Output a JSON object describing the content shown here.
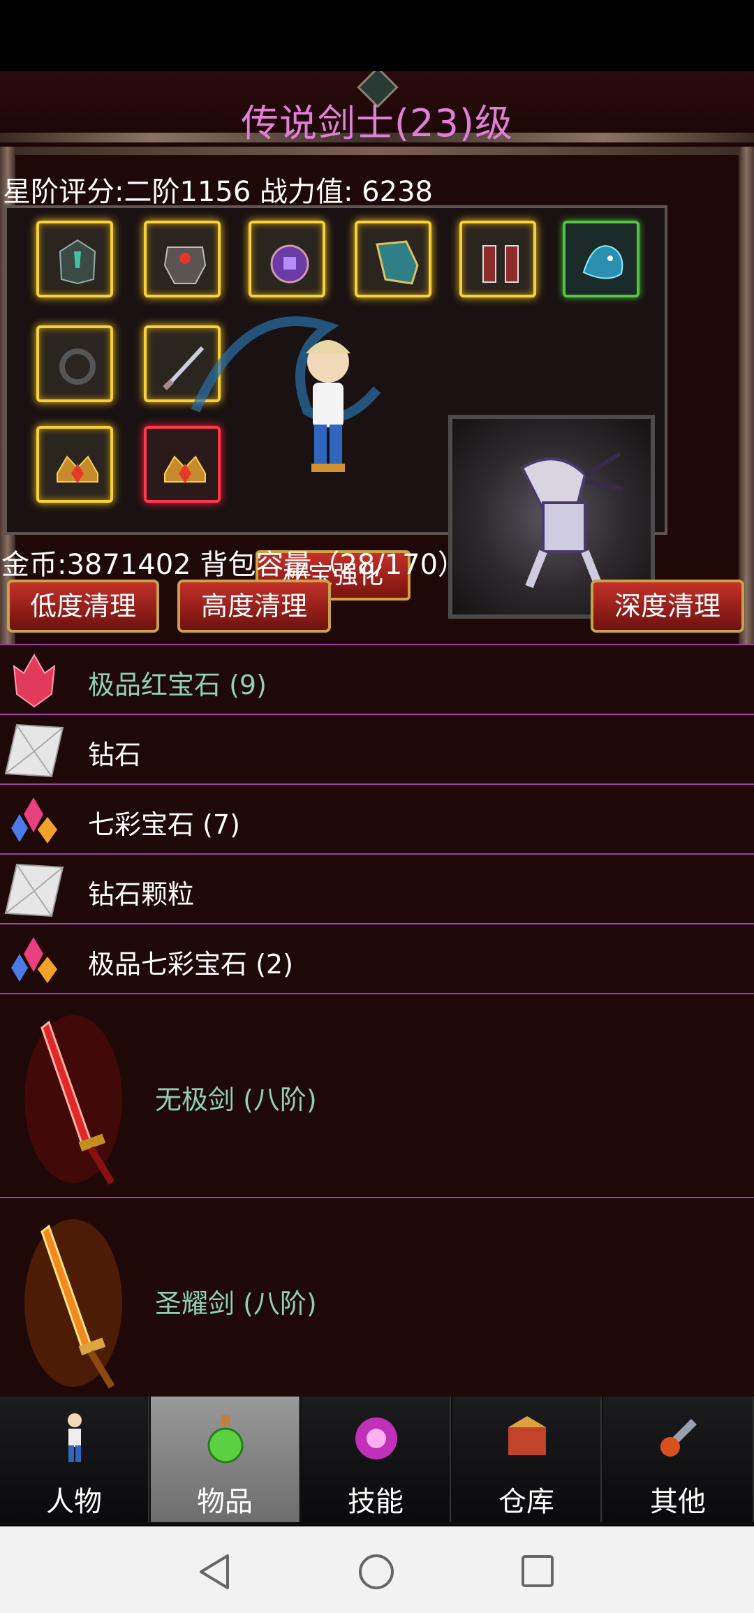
{
  "header": {
    "title": "传说剑士(23)级"
  },
  "stats": {
    "score_line": "星阶评分:二阶1156 战力值:  6238"
  },
  "equip": {
    "secret_button": "秘宝强化"
  },
  "inventory": {
    "gold_line": "金币:3871402 背包容量（28/170）",
    "clean_buttons": [
      "低度清理",
      "高度清理",
      "深度清理"
    ],
    "items": [
      {
        "name": "极品红宝石 (9)",
        "color": "#8fd0b4",
        "icon": "red-crystal-icon"
      },
      {
        "name": "钻石",
        "color": "#ffffff",
        "icon": "diamond-icon"
      },
      {
        "name": "七彩宝石 (7)",
        "color": "#ffffff",
        "icon": "rainbow-gem-icon"
      },
      {
        "name": "钻石颗粒",
        "color": "#ffffff",
        "icon": "diamond-particle-icon"
      },
      {
        "name": "极品七彩宝石 (2)",
        "color": "#ffffff",
        "icon": "rainbow-gem-icon"
      },
      {
        "name": "无极剑 (八阶)",
        "color": "#8fd0b4",
        "icon": "red-sword-icon"
      },
      {
        "name": "圣耀剑 (八阶)",
        "color": "#8fd0b4",
        "icon": "fire-sword-icon"
      }
    ]
  },
  "tabs": [
    {
      "label": "人物",
      "icon": "character-icon",
      "active": false
    },
    {
      "label": "物品",
      "icon": "potion-icon",
      "active": true
    },
    {
      "label": "技能",
      "icon": "skill-orb-icon",
      "active": false
    },
    {
      "label": "仓库",
      "icon": "warehouse-icon",
      "active": false
    },
    {
      "label": "其他",
      "icon": "other-icon",
      "active": false
    }
  ],
  "colors": {
    "title": "#e07fd8",
    "item_highlight": "#8fd0b4",
    "divider": "#a03fa8",
    "button_red": "#c4302a"
  }
}
